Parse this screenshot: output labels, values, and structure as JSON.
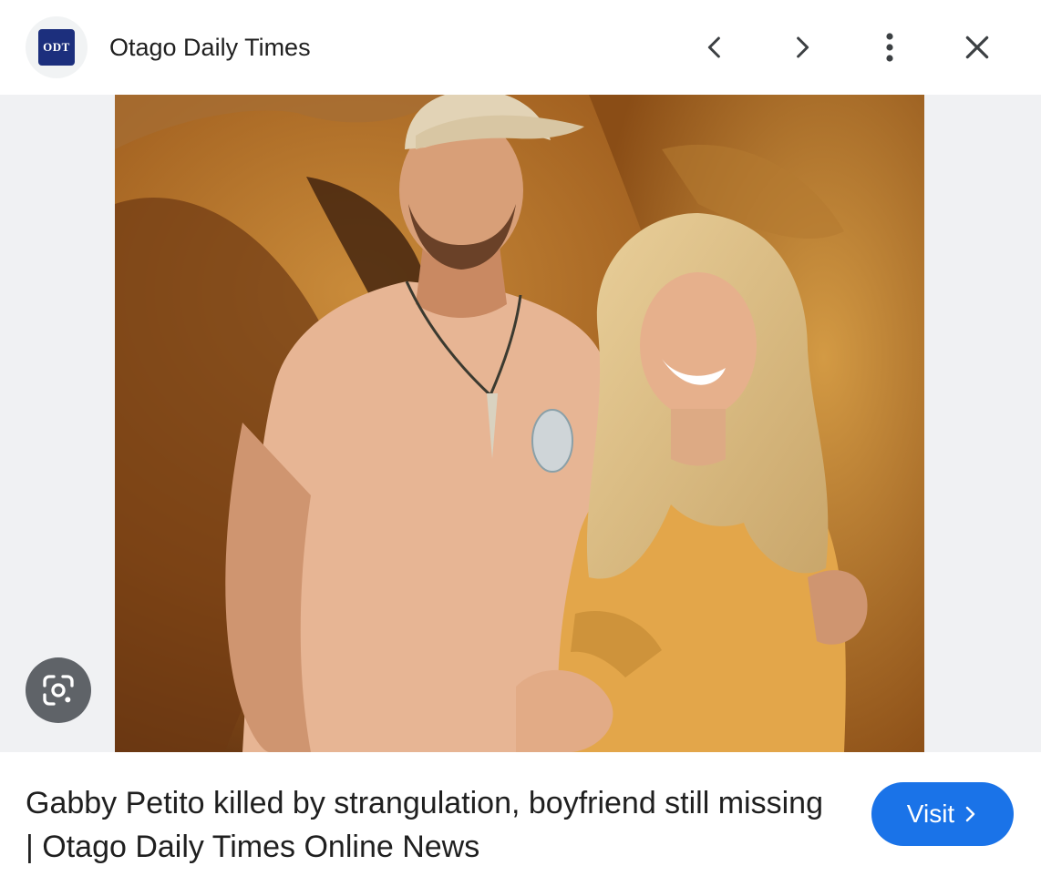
{
  "header": {
    "logo_text": "ODT",
    "site_name": "Otago Daily Times",
    "buttons": {
      "prev_icon": "chevron-left-icon",
      "next_icon": "chevron-right-icon",
      "more_icon": "more-vert-icon",
      "close_icon": "close-icon"
    }
  },
  "image": {
    "lens_icon": "google-lens-icon"
  },
  "footer": {
    "title": "Gabby Petito killed by strangulation, boyfriend still missing | Otago Daily Times Online News",
    "visit_label": "Visit"
  },
  "colors": {
    "accent": "#1a73e8",
    "logo_bg": "#1c2f7d",
    "panel_bg": "#f0f1f3"
  }
}
